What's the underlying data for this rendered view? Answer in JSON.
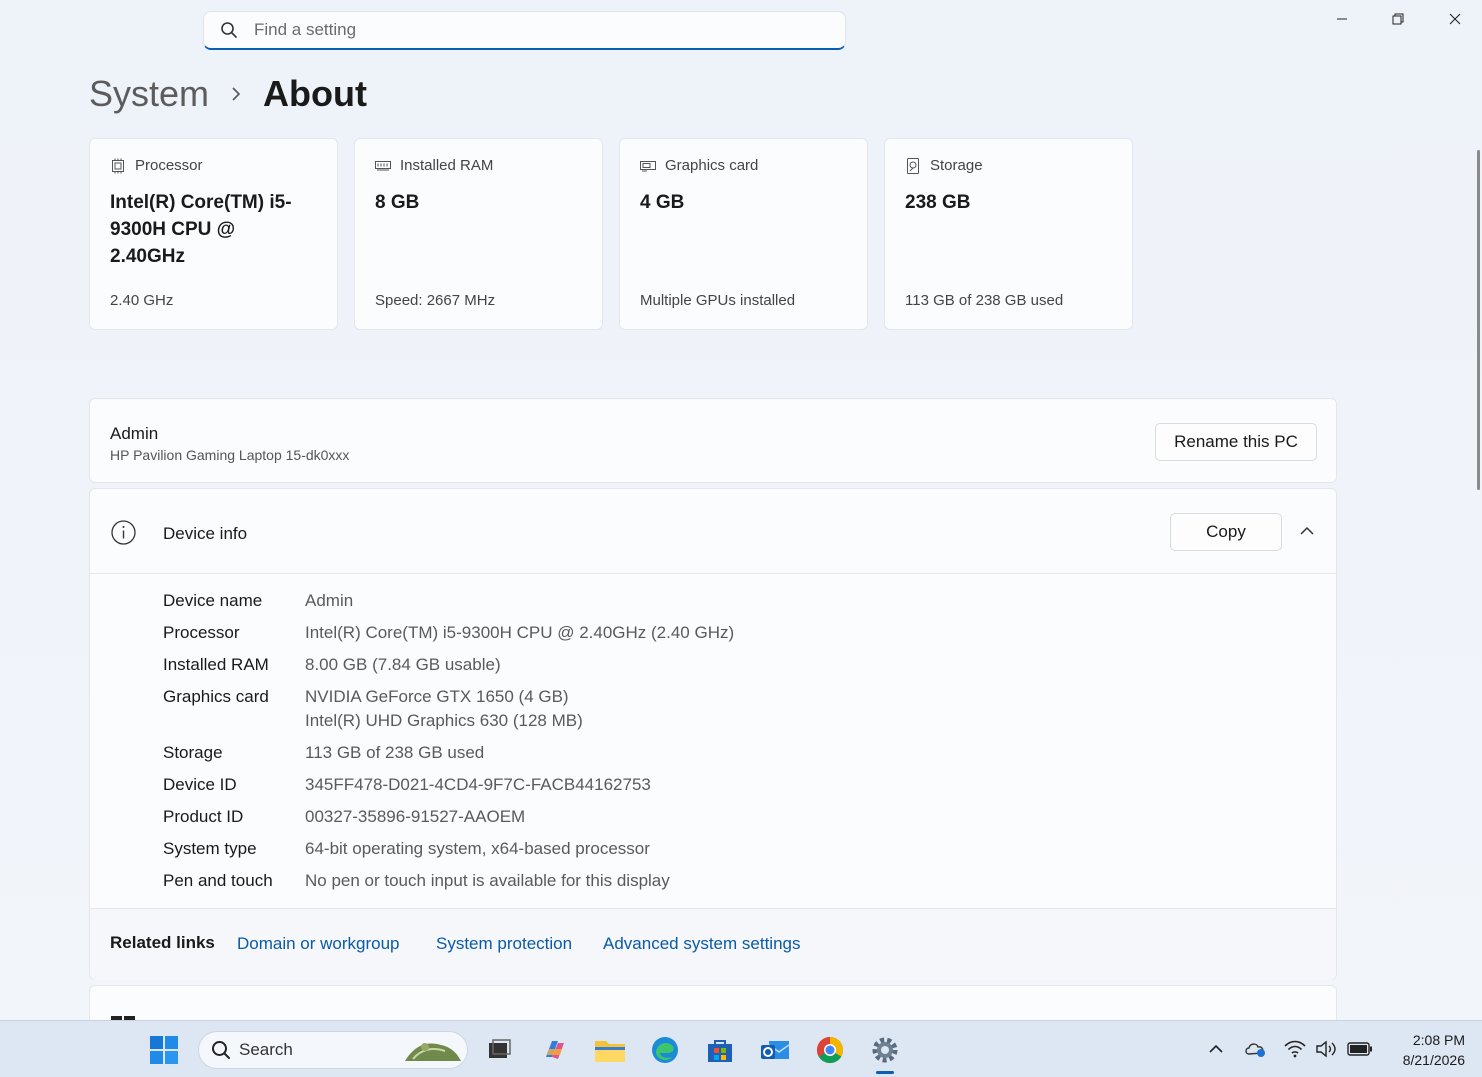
{
  "search": {
    "placeholder": "Find a setting"
  },
  "breadcrumb": {
    "parent": "System",
    "current": "About"
  },
  "specs": [
    {
      "label": "Processor",
      "value": "Intel(R) Core(TM) i5-9300H CPU @ 2.40GHz",
      "sub": "2.40 GHz",
      "icon": "processor-icon"
    },
    {
      "label": "Installed RAM",
      "value": "8 GB",
      "sub": "Speed: 2667 MHz",
      "icon": "ram-icon"
    },
    {
      "label": "Graphics card",
      "value": "4 GB",
      "sub": "Multiple GPUs installed",
      "icon": "graphics-card-icon"
    },
    {
      "label": "Storage",
      "value": "238 GB",
      "sub": "113 GB of 238 GB used",
      "icon": "storage-icon"
    }
  ],
  "pc": {
    "name": "Admin",
    "model": "HP Pavilion Gaming Laptop 15-dk0xxx",
    "rename_label": "Rename this PC"
  },
  "device_info": {
    "title": "Device info",
    "copy_label": "Copy",
    "rows": [
      {
        "key": "Device name",
        "value": "Admin"
      },
      {
        "key": "Processor",
        "value": "Intel(R) Core(TM) i5-9300H CPU @ 2.40GHz (2.40 GHz)"
      },
      {
        "key": "Installed RAM",
        "value": "8.00 GB (7.84 GB usable)"
      },
      {
        "key": "Graphics card",
        "value": "NVIDIA GeForce GTX 1650 (4 GB)",
        "value2": "Intel(R) UHD Graphics 630 (128 MB)"
      },
      {
        "key": "Storage",
        "value": "113 GB of 238 GB used"
      },
      {
        "key": "Device ID",
        "value": "345FF478-D021-4CD4-9F7C-FACB44162753"
      },
      {
        "key": "Product ID",
        "value": "00327-35896-91527-AAOEM"
      },
      {
        "key": "System type",
        "value": "64-bit operating system, x64-based processor"
      },
      {
        "key": "Pen and touch",
        "value": "No pen or touch input is available for this display"
      }
    ]
  },
  "related": {
    "label": "Related links",
    "links": [
      "Domain or workgroup",
      "System protection",
      "Advanced system settings"
    ]
  },
  "taskbar": {
    "search_label": "Search",
    "time": "2:08 PM",
    "date": "8/21/2026"
  },
  "colors": {
    "accent": "#0a5fb4",
    "link": "#0b5aa6",
    "background": "#f0f4f9"
  }
}
